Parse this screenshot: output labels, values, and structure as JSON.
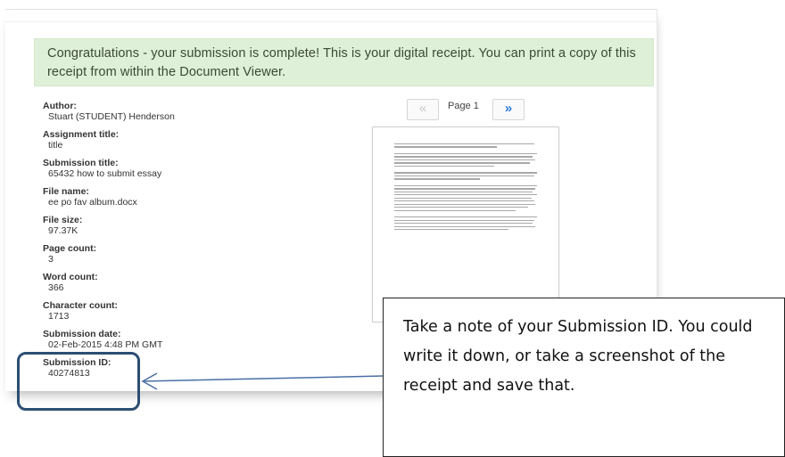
{
  "banner": {
    "message": "Congratulations - your submission is complete! This is your digital receipt. You can print a copy of this receipt from within the Document Viewer."
  },
  "fields": [
    {
      "label": "Author:",
      "value": "Stuart (STUDENT) Henderson"
    },
    {
      "label": "Assignment title:",
      "value": "title"
    },
    {
      "label": "Submission title:",
      "value": "65432 how to submit essay"
    },
    {
      "label": "File name:",
      "value": "ee po fav album.docx"
    },
    {
      "label": "File size:",
      "value": "97.37K"
    },
    {
      "label": "Page count:",
      "value": "3"
    },
    {
      "label": "Word count:",
      "value": "366"
    },
    {
      "label": "Character count:",
      "value": "1713"
    },
    {
      "label": "Submission date:",
      "value": "02-Feb-2015 4:48 PM GMT"
    },
    {
      "label": "Submission ID:",
      "value": "40274813"
    }
  ],
  "pager": {
    "prev_icon": "«",
    "next_icon": "»",
    "page_label": "Page 1"
  },
  "callout": {
    "text": "Take a note of your Submission ID. You could write it down, or take a screenshot of the receipt and save that."
  },
  "colors": {
    "banner_bg": "#dff0d8",
    "next_button": "#2a7bd8",
    "highlight_border": "#2d4e73",
    "arrow": "#4a6fa5"
  }
}
